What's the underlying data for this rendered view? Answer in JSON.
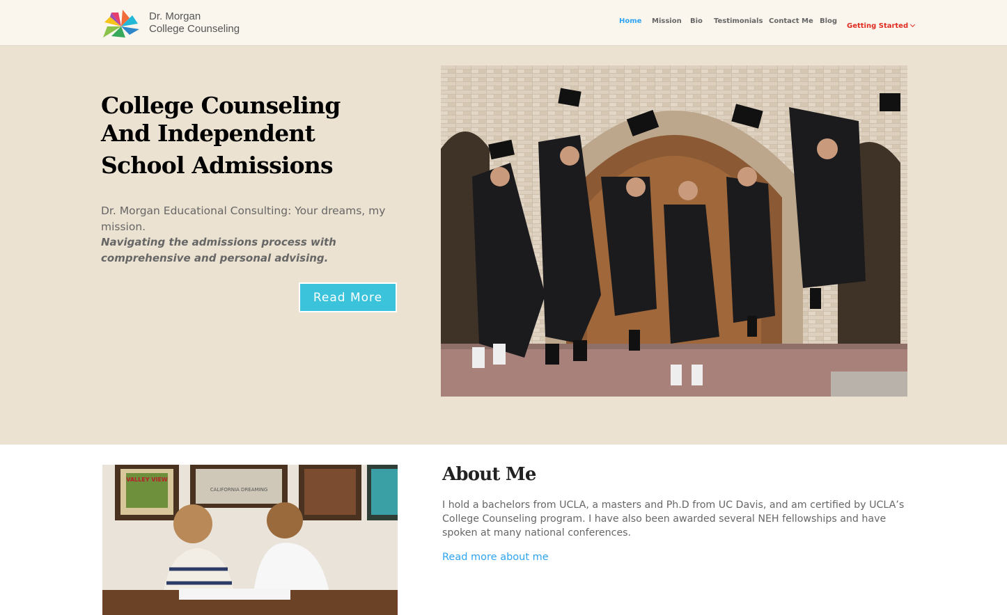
{
  "brand": {
    "name_line1": "Dr. Morgan",
    "name_line2": "College Counseling"
  },
  "nav": {
    "items": [
      {
        "label": "Home",
        "state": "active"
      },
      {
        "label": "Mission"
      },
      {
        "label": "Bio"
      },
      {
        "label": "Testimonials"
      },
      {
        "label": "Contact Me"
      },
      {
        "label": "Blog"
      },
      {
        "label": "Getting Started",
        "has_dropdown": true
      }
    ]
  },
  "hero": {
    "title_line1": "College Counseling",
    "title_line2": "And Independent",
    "title_line3": "School Admissions",
    "subtitle": "Dr. Morgan Educational Consulting: Your dreams, my mission.",
    "tagline": "Navigating the admissions process with comprehensive and personal advising.",
    "button_label": "Read More"
  },
  "about": {
    "title": "About Me",
    "body": "I hold a bachelors from UCLA, a masters and Ph.D from UC Davis, and am certified by UCLA’s College Counseling program. I have also been awarded several NEH fellowships and have spoken at many national conferences.",
    "link_label": "Read more about me"
  },
  "photo_text": {
    "poster1": "VALLEY VIEW",
    "poster2": "CALIFORNIA DREAMING"
  },
  "colors": {
    "header_bg": "#faf6ee",
    "hero_bg": "#ebe2d1",
    "nav_active": "#2ea3f2",
    "nav_accent": "#e02b20",
    "button_bg": "#3bc3dc",
    "link": "#2ea3f2"
  }
}
